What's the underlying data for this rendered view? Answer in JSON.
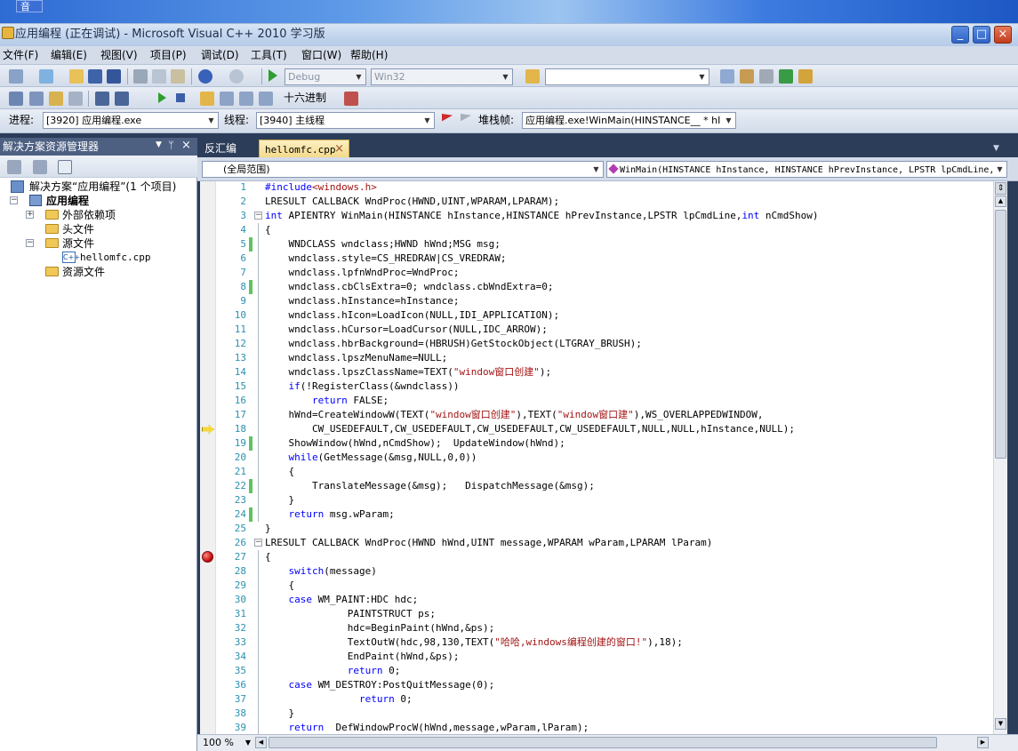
{
  "desktop": {
    "label": "音"
  },
  "window": {
    "title": "应用编程 (正在调试) - Microsoft Visual C++ 2010 学习版"
  },
  "menu": [
    "文件(F)",
    "编辑(E)",
    "视图(V)",
    "项目(P)",
    "调试(D)",
    "工具(T)",
    "窗口(W)",
    "帮助(H)"
  ],
  "toolbar1": {
    "config": "Debug",
    "platform": "Win32",
    "search": ""
  },
  "toolbar2": {
    "hex_label": "十六进制"
  },
  "debugbar": {
    "process_label": "进程:",
    "process_value": "[3920] 应用编程.exe",
    "thread_label": "线程:",
    "thread_value": "[3940] 主线程",
    "stack_label": "堆栈帧:",
    "stack_value": "应用编程.exe!WinMain(HINSTANCE__ * hI"
  },
  "solution_explorer": {
    "title": "解决方案资源管理器",
    "solution": "解决方案“应用编程”(1 个项目)",
    "project": "应用编程",
    "nodes": [
      "外部依赖项",
      "头文件",
      "源文件",
      "hellomfc.cpp",
      "资源文件"
    ]
  },
  "editor": {
    "tabs": [
      "反汇编",
      "hellomfc.cpp"
    ],
    "scope": "(全局范围)",
    "member": "WinMain(HINSTANCE hInstance, HINSTANCE hPrevInstance, LPSTR lpCmdLine,",
    "zoom": "100 %",
    "current_line": 18,
    "breakpoint_line": 27,
    "changed_lines": [
      5,
      8,
      19,
      22,
      24
    ],
    "lines": [
      "#include<windows.h>",
      "LRESULT CALLBACK WndProc(HWND,UINT,WPARAM,LPARAM);",
      "int APIENTRY WinMain(HINSTANCE hInstance,HINSTANCE hPrevInstance,LPSTR lpCmdLine,int nCmdShow)",
      "{",
      "    WNDCLASS wndclass;HWND hWnd;MSG msg;",
      "    wndclass.style=CS_HREDRAW|CS_VREDRAW;",
      "    wndclass.lpfnWndProc=WndProc;",
      "    wndclass.cbClsExtra=0; wndclass.cbWndExtra=0;",
      "    wndclass.hInstance=hInstance;",
      "    wndclass.hIcon=LoadIcon(NULL,IDI_APPLICATION);",
      "    wndclass.hCursor=LoadCursor(NULL,IDC_ARROW);",
      "    wndclass.hbrBackground=(HBRUSH)GetStockObject(LTGRAY_BRUSH);",
      "    wndclass.lpszMenuName=NULL;",
      "    wndclass.lpszClassName=TEXT(\"window窗口创建\");",
      "    if(!RegisterClass(&wndclass))",
      "        return FALSE;",
      "    hWnd=CreateWindowW(TEXT(\"window窗口创建\"),TEXT(\"window窗口建\"),WS_OVERLAPPEDWINDOW,",
      "        CW_USEDEFAULT,CW_USEDEFAULT,CW_USEDEFAULT,CW_USEDEFAULT,NULL,NULL,hInstance,NULL);",
      "    ShowWindow(hWnd,nCmdShow);  UpdateWindow(hWnd);",
      "    while(GetMessage(&msg,NULL,0,0))",
      "    {",
      "        TranslateMessage(&msg);   DispatchMessage(&msg);",
      "    }",
      "    return msg.wParam;",
      "}",
      "LRESULT CALLBACK WndProc(HWND hWnd,UINT message,WPARAM wParam,LPARAM lParam)",
      "{",
      "    switch(message)",
      "    {",
      "    case WM_PAINT:HDC hdc;",
      "              PAINTSTRUCT ps;",
      "              hdc=BeginPaint(hWnd,&ps);",
      "              TextOutW(hdc,98,130,TEXT(\"哈哈,windows编程创建的窗口!\"),18);",
      "              EndPaint(hWnd,&ps);",
      "              return 0;",
      "    case WM_DESTROY:PostQuitMessage(0);",
      "                return 0;",
      "    }",
      "    return  DefWindowProcW(hWnd,message,wParam,lParam);"
    ]
  },
  "colors": {
    "keyword": "#0000ff",
    "string": "#a31515",
    "line_number": "#2b91af",
    "changed_marker": "#5fc35f",
    "breakpoint": "#c00000",
    "frame_bg": "#2c3d5a"
  }
}
